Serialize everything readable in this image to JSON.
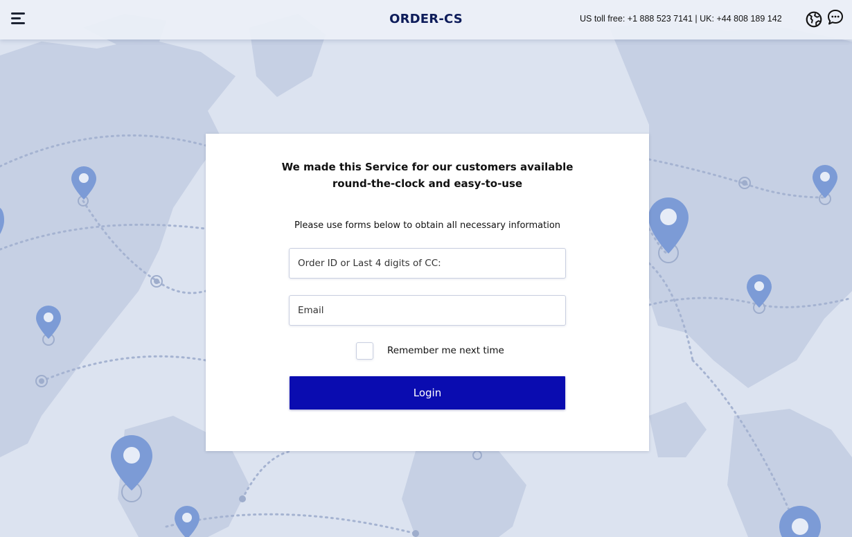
{
  "header": {
    "brand": "ORDER-CS",
    "phones": "US toll free: +1 888 523 7141 | UK: +44 808 189 142",
    "menu_icon": "hamburger-menu-icon",
    "globe_icon": "globe-icon",
    "chat_icon": "chat-bubble-icon"
  },
  "card": {
    "title_line1": "We made this Service for our customers available",
    "title_line2": "round-the-clock and easy-to-use",
    "subtitle": "Please use forms below to obtain all necessary information",
    "order_placeholder": "Order ID or Last 4 digits of CC:",
    "email_placeholder": "Email",
    "remember_label": "Remember me next time",
    "login_label": "Login"
  },
  "colors": {
    "background": "#dbe2ef",
    "map_land": "#c3cde2",
    "pin": "#7a9ad6",
    "brand_text": "#0d1c5a",
    "login_button": "#0a0cb0"
  }
}
